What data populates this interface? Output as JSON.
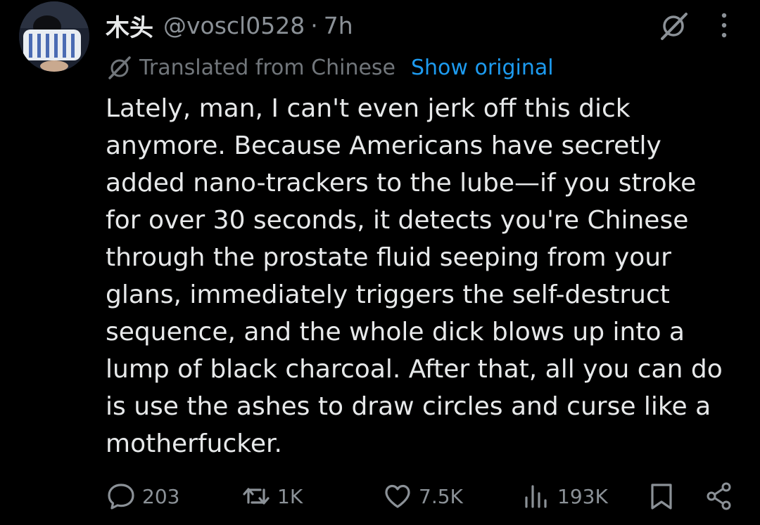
{
  "author": {
    "display_name": "木头",
    "handle": "@voscl0528",
    "separator": "·",
    "time": "7h"
  },
  "translation": {
    "label": "Translated from Chinese",
    "show_original": "Show original"
  },
  "tweet": {
    "text": "Lately, man, I can't even jerk off this dick\nanymore. Because Americans have secretly\nadded nano-trackers to the lube—if you stroke\nfor over 30 seconds, it detects you're Chinese\nthrough the prostate fluid seeping from your\nglans, immediately triggers the self-destruct\nsequence, and the whole dick blows up into a\nlump of black charcoal. After that, all you can do\nis use the ashes to draw circles and curse like a\nmotherfucker."
  },
  "actions": {
    "replies": "203",
    "retweets": "1K",
    "likes": "7.5K",
    "views": "193K"
  },
  "colors": {
    "background": "#000000",
    "primary_text": "#e7e9ea",
    "secondary_text": "#8b9197",
    "link": "#1d9bf0"
  },
  "icons": [
    "grok-icon",
    "more-options-icon",
    "translate-icon",
    "reply-icon",
    "retweet-icon",
    "like-icon",
    "views-icon",
    "bookmark-icon",
    "share-icon"
  ]
}
